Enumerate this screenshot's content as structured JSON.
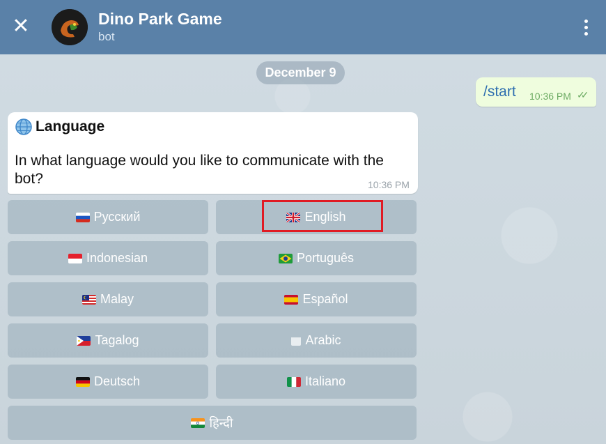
{
  "header": {
    "close_icon": "close-icon",
    "title": "Dino Park Game",
    "subtitle": "bot",
    "menu_icon": "more-vertical-icon",
    "bg_color": "#5a81a8"
  },
  "chat": {
    "date": "December 9",
    "outgoing": {
      "text": "/start",
      "time": "10:36 PM",
      "status_icon": "double-check-icon"
    },
    "incoming": {
      "title_icon": "globe-icon",
      "title": "Language",
      "text": "In what language would you like to communicate with the bot?",
      "time": "10:36 PM"
    }
  },
  "keyboard": {
    "buttons": [
      {
        "label": "Русский",
        "flag": "russia-flag-icon"
      },
      {
        "label": "English",
        "flag": "uk-flag-icon"
      },
      {
        "label": "Indonesian",
        "flag": "indonesia-flag-icon"
      },
      {
        "label": "Português",
        "flag": "brazil-flag-icon"
      },
      {
        "label": "Malay",
        "flag": "malaysia-flag-icon"
      },
      {
        "label": "Español",
        "flag": "spain-flag-icon"
      },
      {
        "label": "Tagalog",
        "flag": "philippines-flag-icon"
      },
      {
        "label": "Arabic",
        "flag": "blank-flag-icon"
      },
      {
        "label": "Deutsch",
        "flag": "germany-flag-icon"
      },
      {
        "label": "Italiano",
        "flag": "italy-flag-icon"
      },
      {
        "label": "हिन्दी",
        "flag": "india-flag-icon"
      }
    ],
    "highlighted": "English",
    "highlight_color": "#e01b24"
  }
}
